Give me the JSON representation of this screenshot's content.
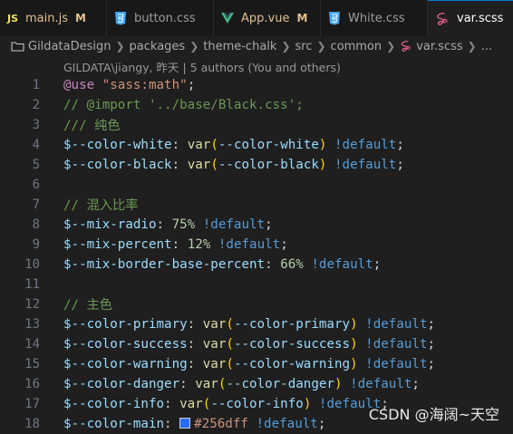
{
  "tabs": [
    {
      "icon": "JS",
      "label": "main.js",
      "modified": "M"
    },
    {
      "label": "button.css"
    },
    {
      "label": "App.vue",
      "modified": "M"
    },
    {
      "label": "White.css"
    },
    {
      "label": "var.scss"
    }
  ],
  "breadcrumb": [
    "GildataDesign",
    "packages",
    "theme-chalk",
    "src",
    "common",
    "var.scss",
    "..."
  ],
  "blame": "GILDATA\\jiangy, 昨天 | 5 authors (You and others)",
  "line_numbers": [
    "1",
    "2",
    "3",
    "4",
    "5",
    "6",
    "7",
    "8",
    "9",
    "10",
    "11",
    "12",
    "13",
    "14",
    "15",
    "16",
    "17",
    "18"
  ],
  "code": {
    "l1": {
      "kw": "@use",
      "str": "\"sass:math\"",
      "end": ";"
    },
    "l2": {
      "comment": "// @import '../base/Black.css';"
    },
    "l3": {
      "comment": "/// 纯色"
    },
    "l4": {
      "var": "$--color-white",
      "fn": "var",
      "arg": "--color-white",
      "imp": "!default"
    },
    "l5": {
      "var": "$--color-black",
      "fn": "var",
      "arg": "--color-black",
      "imp": "!default"
    },
    "l7": {
      "comment": "// 混入比率"
    },
    "l8": {
      "var": "$--mix-radio",
      "num": "75%",
      "imp": "!default"
    },
    "l9": {
      "var": "$--mix-percent",
      "num": "12%",
      "imp": "!default"
    },
    "l10": {
      "var": "$--mix-border-base-percent",
      "num": "66%",
      "imp": "!default"
    },
    "l12": {
      "comment": "// 主色"
    },
    "l13": {
      "var": "$--color-primary",
      "fn": "var",
      "arg": "--color-primary",
      "imp": "!default"
    },
    "l14": {
      "var": "$--color-success",
      "fn": "var",
      "arg": "--color-success",
      "imp": "!default"
    },
    "l15": {
      "var": "$--color-warning",
      "fn": "var",
      "arg": "--color-warning",
      "imp": "!default"
    },
    "l16": {
      "var": "$--color-danger",
      "fn": "var",
      "arg": "--color-danger",
      "imp": "!default"
    },
    "l17": {
      "var": "$--color-info",
      "fn": "var",
      "arg": "--color-info",
      "imp": "!default"
    },
    "l18": {
      "var": "$--color-main",
      "hex": "#256dff",
      "swatch": "#256dff",
      "imp": "!default"
    }
  },
  "watermark": "CSDN @海阔~天空",
  "colors": {
    "accent": "#0078d4",
    "keyword": "#c586c0",
    "comment": "#6a9955",
    "variable": "#9cdcfe",
    "function": "#dcdcaa",
    "bracket": "#ffd700",
    "important": "#569cd6",
    "number": "#b5cea8",
    "string": "#ce9178"
  }
}
